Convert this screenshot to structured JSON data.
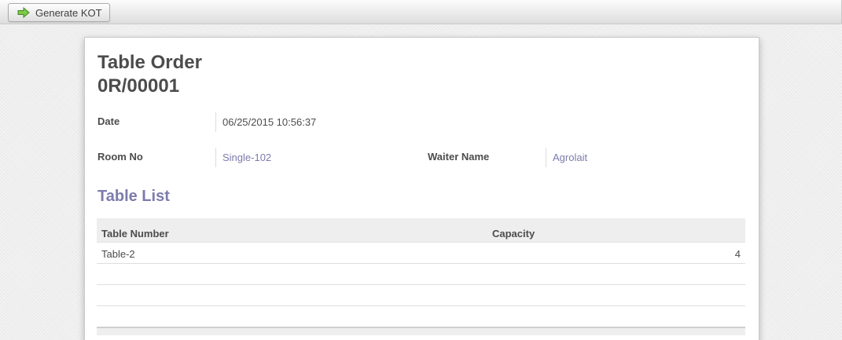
{
  "toolbar": {
    "generate_kot_label": "Generate KOT"
  },
  "form": {
    "title_line1": "Table Order",
    "title_line2": "0R/00001",
    "date_label": "Date",
    "date_value": "06/25/2015 10:56:37",
    "room_label": "Room No",
    "room_value": "Single-102",
    "waiter_label": "Waiter Name",
    "waiter_value": "Agrolait",
    "section_title": "Table List",
    "table": {
      "columns": [
        "Table Number",
        "Capacity"
      ],
      "rows": [
        {
          "table_number": "Table-2",
          "capacity": "4"
        }
      ]
    }
  },
  "colors": {
    "link": "#7c7bad",
    "text": "#4c4c4c",
    "header_bg": "#eeeeee"
  }
}
